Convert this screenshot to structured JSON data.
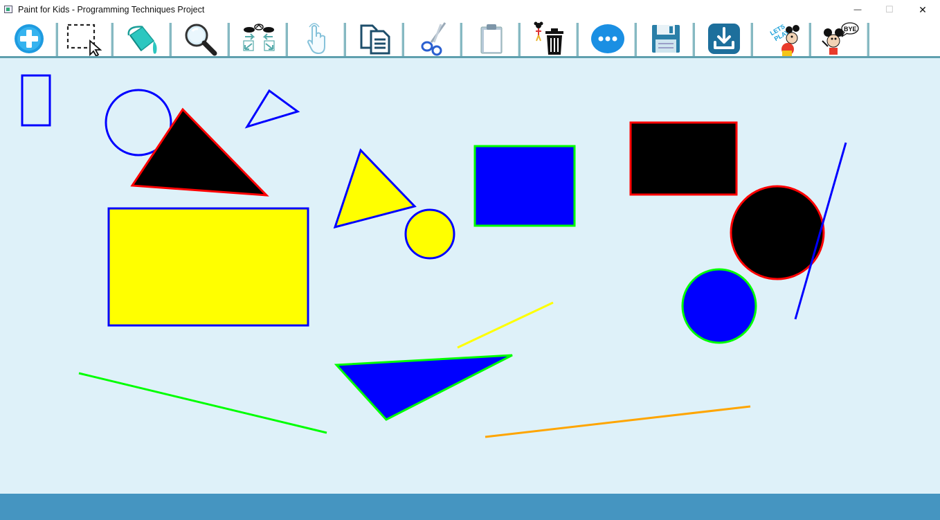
{
  "window": {
    "title": "Paint for Kids - Programming Techniques Project",
    "minimize_glyph": "—",
    "maximize_glyph": "☐",
    "close_glyph": "✕"
  },
  "toolbar": {
    "tools": [
      {
        "id": "add",
        "icon": "plus-circle-icon"
      },
      {
        "id": "select",
        "icon": "select-rectangle-icon"
      },
      {
        "id": "fill",
        "icon": "paint-bucket-icon"
      },
      {
        "id": "zoom",
        "icon": "magnifier-icon"
      },
      {
        "id": "resize",
        "icon": "resize-arrows-icon"
      },
      {
        "id": "move",
        "icon": "hand-pointer-icon"
      },
      {
        "id": "copy",
        "icon": "copy-icon"
      },
      {
        "id": "cut",
        "icon": "scissors-icon"
      },
      {
        "id": "paste",
        "icon": "clipboard-icon"
      },
      {
        "id": "delete",
        "icon": "trash-icon"
      },
      {
        "id": "more",
        "icon": "more-dots-icon"
      },
      {
        "id": "save",
        "icon": "floppy-disk-icon"
      },
      {
        "id": "load",
        "icon": "download-icon"
      },
      {
        "id": "play",
        "icon": "lets-play-mascot-icon",
        "label": "LETS PLAY !"
      },
      {
        "id": "exit",
        "icon": "bye-mascot-icon",
        "label": "BYE"
      }
    ]
  },
  "colors": {
    "canvas_bg": "#def1f9",
    "status_bar": "#4595c1",
    "toolbar_border": "#5f9fae",
    "blue": "#0000ff",
    "red": "#ff0000",
    "green": "#00ff00",
    "yellow": "#ffff00",
    "orange": "#ffa500",
    "black": "#000000"
  },
  "drawing": {
    "shapes": [
      {
        "name": "small-blue-rectangle",
        "type": "rectangle",
        "fill": "none",
        "stroke": "blue"
      },
      {
        "name": "blue-outline-circle",
        "type": "circle",
        "fill": "none",
        "stroke": "blue"
      },
      {
        "name": "black-triangle",
        "type": "triangle",
        "fill": "black",
        "stroke": "red"
      },
      {
        "name": "small-blue-outline-triangle",
        "type": "triangle",
        "fill": "none",
        "stroke": "blue"
      },
      {
        "name": "yellow-rectangle",
        "type": "rectangle",
        "fill": "yellow",
        "stroke": "blue"
      },
      {
        "name": "yellow-triangle",
        "type": "triangle",
        "fill": "yellow",
        "stroke": "blue"
      },
      {
        "name": "yellow-circle",
        "type": "circle",
        "fill": "yellow",
        "stroke": "blue"
      },
      {
        "name": "blue-rectangle",
        "type": "rectangle",
        "fill": "blue",
        "stroke": "green"
      },
      {
        "name": "black-rectangle",
        "type": "rectangle",
        "fill": "black",
        "stroke": "red"
      },
      {
        "name": "black-circle",
        "type": "circle",
        "fill": "black",
        "stroke": "red"
      },
      {
        "name": "blue-circle",
        "type": "circle",
        "fill": "blue",
        "stroke": "green"
      },
      {
        "name": "blue-line",
        "type": "line",
        "stroke": "blue"
      },
      {
        "name": "yellow-line",
        "type": "line",
        "stroke": "yellow"
      },
      {
        "name": "blue-triangle",
        "type": "triangle",
        "fill": "blue",
        "stroke": "green"
      },
      {
        "name": "green-line",
        "type": "line",
        "stroke": "green"
      },
      {
        "name": "orange-line",
        "type": "line",
        "stroke": "orange"
      }
    ]
  }
}
